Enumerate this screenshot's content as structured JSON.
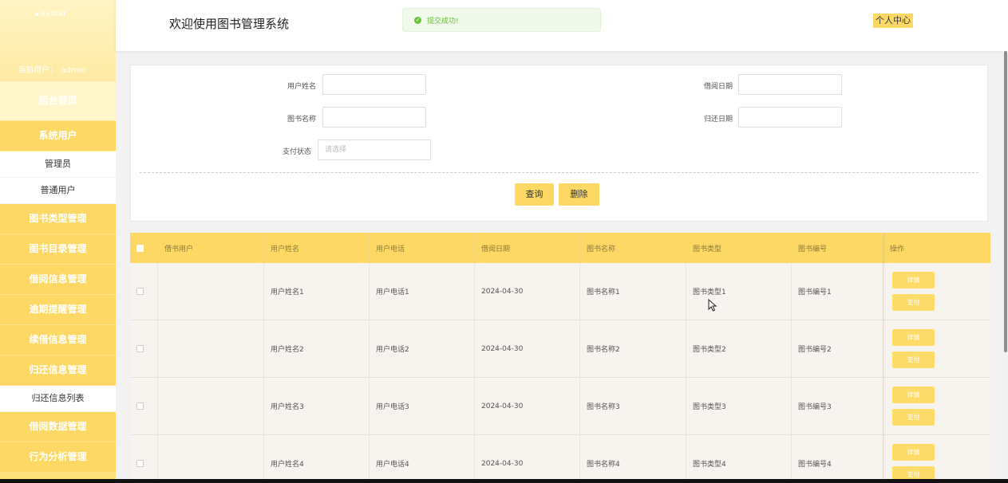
{
  "sidebar": {
    "avatar_text": "avatar",
    "current_user_label": "当前用户：",
    "current_user": "admin",
    "home": "后台首页",
    "groups": [
      {
        "label": "系统用户",
        "children": [
          "管理员",
          "普通用户"
        ]
      },
      {
        "label": "图书类型管理",
        "children": []
      },
      {
        "label": "图书目录管理",
        "children": []
      },
      {
        "label": "借阅信息管理",
        "children": []
      },
      {
        "label": "逾期提醒管理",
        "children": []
      },
      {
        "label": "续借信息管理",
        "children": []
      },
      {
        "label": "归还信息管理",
        "children": [
          "归还信息列表"
        ]
      },
      {
        "label": "借阅数据管理",
        "children": []
      },
      {
        "label": "行为分析管理",
        "children": []
      }
    ]
  },
  "header": {
    "title": "欢迎使用图书管理系统",
    "toast": "提交成功!",
    "profile": "个人中心"
  },
  "search": {
    "user_name_label": "用户姓名",
    "borrow_date_label": "借阅日期",
    "book_name_label": "图书名称",
    "return_date_label": "归还日期",
    "pay_status_label": "支付状态",
    "pay_status_placeholder": "请选择",
    "query_button": "查询",
    "delete_button": "删除"
  },
  "table": {
    "columns": [
      "借书用户",
      "用户姓名",
      "用户电话",
      "借阅日期",
      "图书名称",
      "图书类型",
      "图书编号",
      "操作"
    ],
    "rows": [
      {
        "borrower": "",
        "name": "用户姓名1",
        "phone": "用户电话1",
        "date": "2024-04-30",
        "book": "图书名称1",
        "type": "图书类型1",
        "code": "图书编号1"
      },
      {
        "borrower": "",
        "name": "用户姓名2",
        "phone": "用户电话2",
        "date": "2024-04-30",
        "book": "图书名称2",
        "type": "图书类型2",
        "code": "图书编号2"
      },
      {
        "borrower": "",
        "name": "用户姓名3",
        "phone": "用户电话3",
        "date": "2024-04-30",
        "book": "图书名称3",
        "type": "图书类型3",
        "code": "图书编号3"
      },
      {
        "borrower": "",
        "name": "用户姓名4",
        "phone": "用户电话4",
        "date": "2024-04-30",
        "book": "图书名称4",
        "type": "图书类型4",
        "code": "图书编号4"
      }
    ],
    "detail_button": "详情",
    "pay_button": "支付"
  },
  "colors": {
    "accent": "#fdd865",
    "sidebar_bg": "#fde07a",
    "toast_text": "#67c23a"
  }
}
